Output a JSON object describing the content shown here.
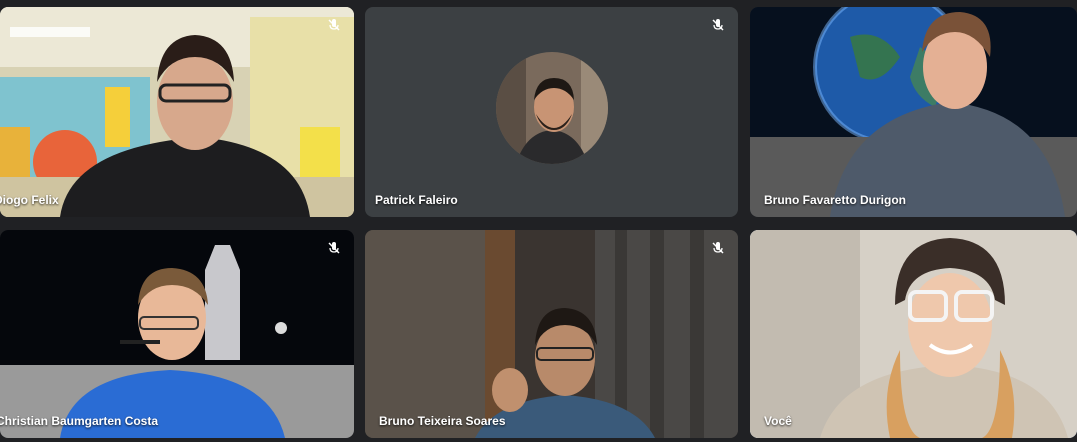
{
  "participants": [
    {
      "name": "Diogo Felix",
      "muted": true
    },
    {
      "name": "Patrick Faleiro",
      "muted": true
    },
    {
      "name": "Bruno Favaretto Durigon",
      "muted": false
    },
    {
      "name": "Christian Baumgarten Costa",
      "muted": true
    },
    {
      "name": "Bruno Teixeira Soares",
      "muted": true
    },
    {
      "name": "Você",
      "muted": false,
      "active_speaker": true
    }
  ],
  "colors": {
    "background": "#202124",
    "tile": "#3c4043",
    "active_border": "#8ab4f8"
  },
  "icons": [
    "mic-off-icon"
  ]
}
